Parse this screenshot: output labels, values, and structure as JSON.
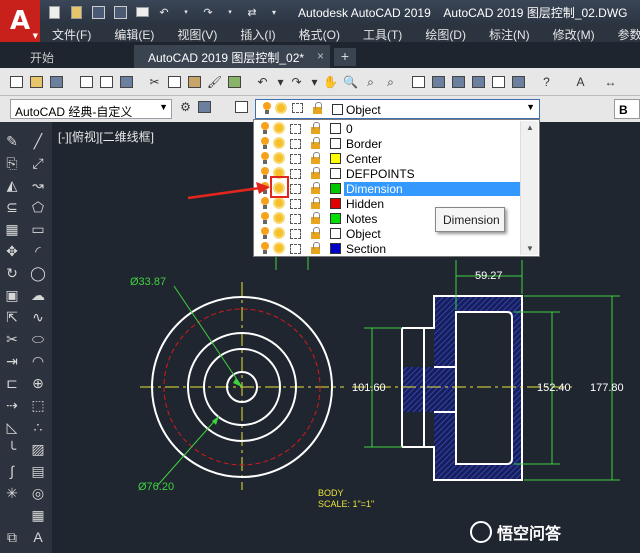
{
  "titlebar": {
    "app_button": "A",
    "title": "Autodesk AutoCAD 2019    AutoCAD 2019 图层控制_02.DWG"
  },
  "menu": [
    "文件(F)",
    "编辑(E)",
    "视图(V)",
    "插入(I)",
    "格式(O)",
    "工具(T)",
    "绘图(D)",
    "标注(N)",
    "修改(M)",
    "参数("
  ],
  "tabs": {
    "start": "开始",
    "document": "AutoCAD 2019 图层控制_02*",
    "close": "×",
    "new": "+"
  },
  "toolbar": {
    "workspace": "AutoCAD 经典-自定义",
    "current_layer": "Object",
    "b_label": "B"
  },
  "viewport_label": "[-][俯视][二维线框]",
  "layer_dropdown": {
    "layers": [
      {
        "name": "0",
        "color": "#ffffff"
      },
      {
        "name": "Border",
        "color": "#ffffff"
      },
      {
        "name": "Center",
        "color": "#ffff00"
      },
      {
        "name": "DEFPOINTS",
        "color": "#ffffff"
      },
      {
        "name": "Dimension",
        "color": "#00c800",
        "selected": true
      },
      {
        "name": "Hidden",
        "color": "#e00000"
      },
      {
        "name": "Notes",
        "color": "#00e000"
      },
      {
        "name": "Object",
        "color": "#ffffff"
      },
      {
        "name": "Section",
        "color": "#0000c8"
      }
    ]
  },
  "tooltip": "Dimension",
  "drawing": {
    "dia_top": "Ø33.87",
    "dia_bottom": "Ø76.20",
    "dim_width": "59.27",
    "dim_left": "101.60",
    "dim_mid": "152.40",
    "dim_right": "177.80",
    "note_title": "BODY",
    "note_scale": "SCALE: 1\"=1\""
  },
  "watermark": "悟空问答",
  "colors": {
    "canvas": "#1f2630",
    "accent_red": "#c8201b",
    "highlight": "#e3261d",
    "selection": "#3399ff"
  }
}
